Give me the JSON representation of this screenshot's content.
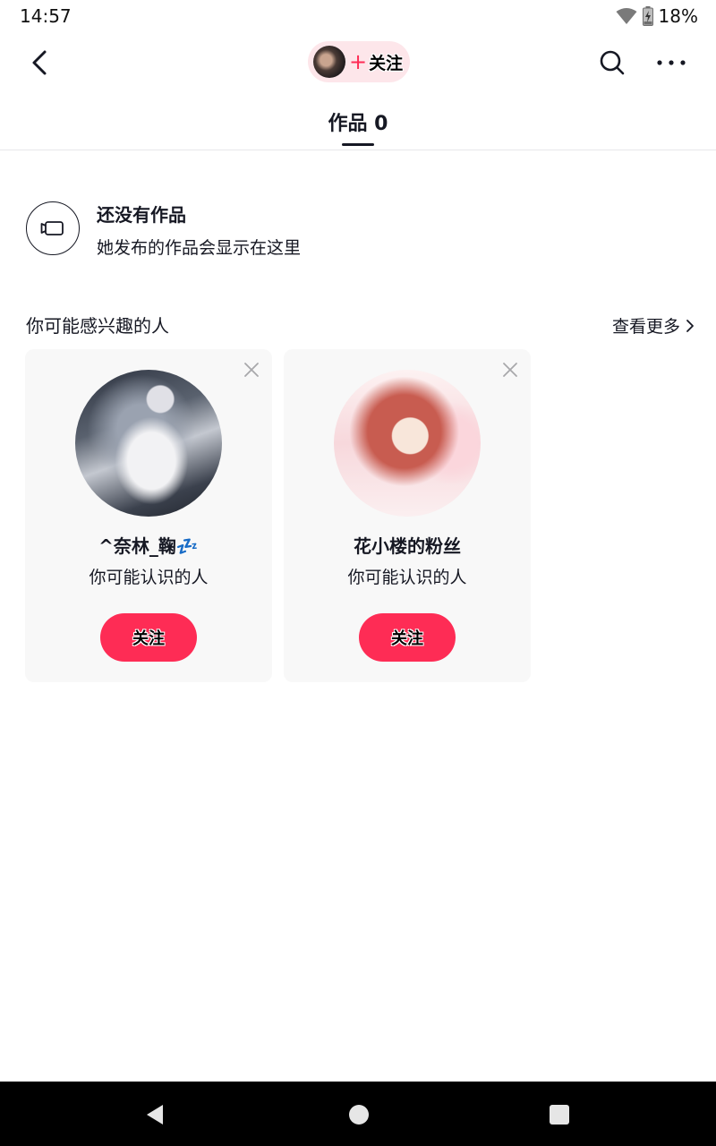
{
  "status_bar": {
    "time": "14:57",
    "battery": "18%",
    "icons": [
      "wifi-icon",
      "battery-charging-icon"
    ]
  },
  "top_nav": {
    "icons": [
      "back-arrow-icon",
      "search-icon",
      "more-dots-icon"
    ],
    "follow_pill": {
      "plus": "+",
      "label": "关注"
    }
  },
  "tabs": [
    {
      "label": "作品 0",
      "active": true
    }
  ],
  "empty_state": {
    "icon": "video-camera-icon",
    "title": "还没有作品",
    "subtitle": "她发布的作品会显示在这里"
  },
  "suggestions": {
    "title": "你可能感兴趣的人",
    "see_more": "查看更多",
    "cards": [
      {
        "name": "^奈林_鞠💤",
        "subtitle": "你可能认识的人",
        "follow_label": "关注"
      },
      {
        "name": "花小楼的粉丝",
        "subtitle": "你可能认识的人",
        "follow_label": "关注"
      }
    ]
  },
  "colors": {
    "accent": "#fe2c55",
    "pill_background": "#fde6ea",
    "card_background": "#f8f8f8",
    "text": "#161823"
  },
  "nav_bar": {
    "icons": [
      "nav-back-icon",
      "nav-home-icon",
      "nav-recents-icon"
    ]
  }
}
